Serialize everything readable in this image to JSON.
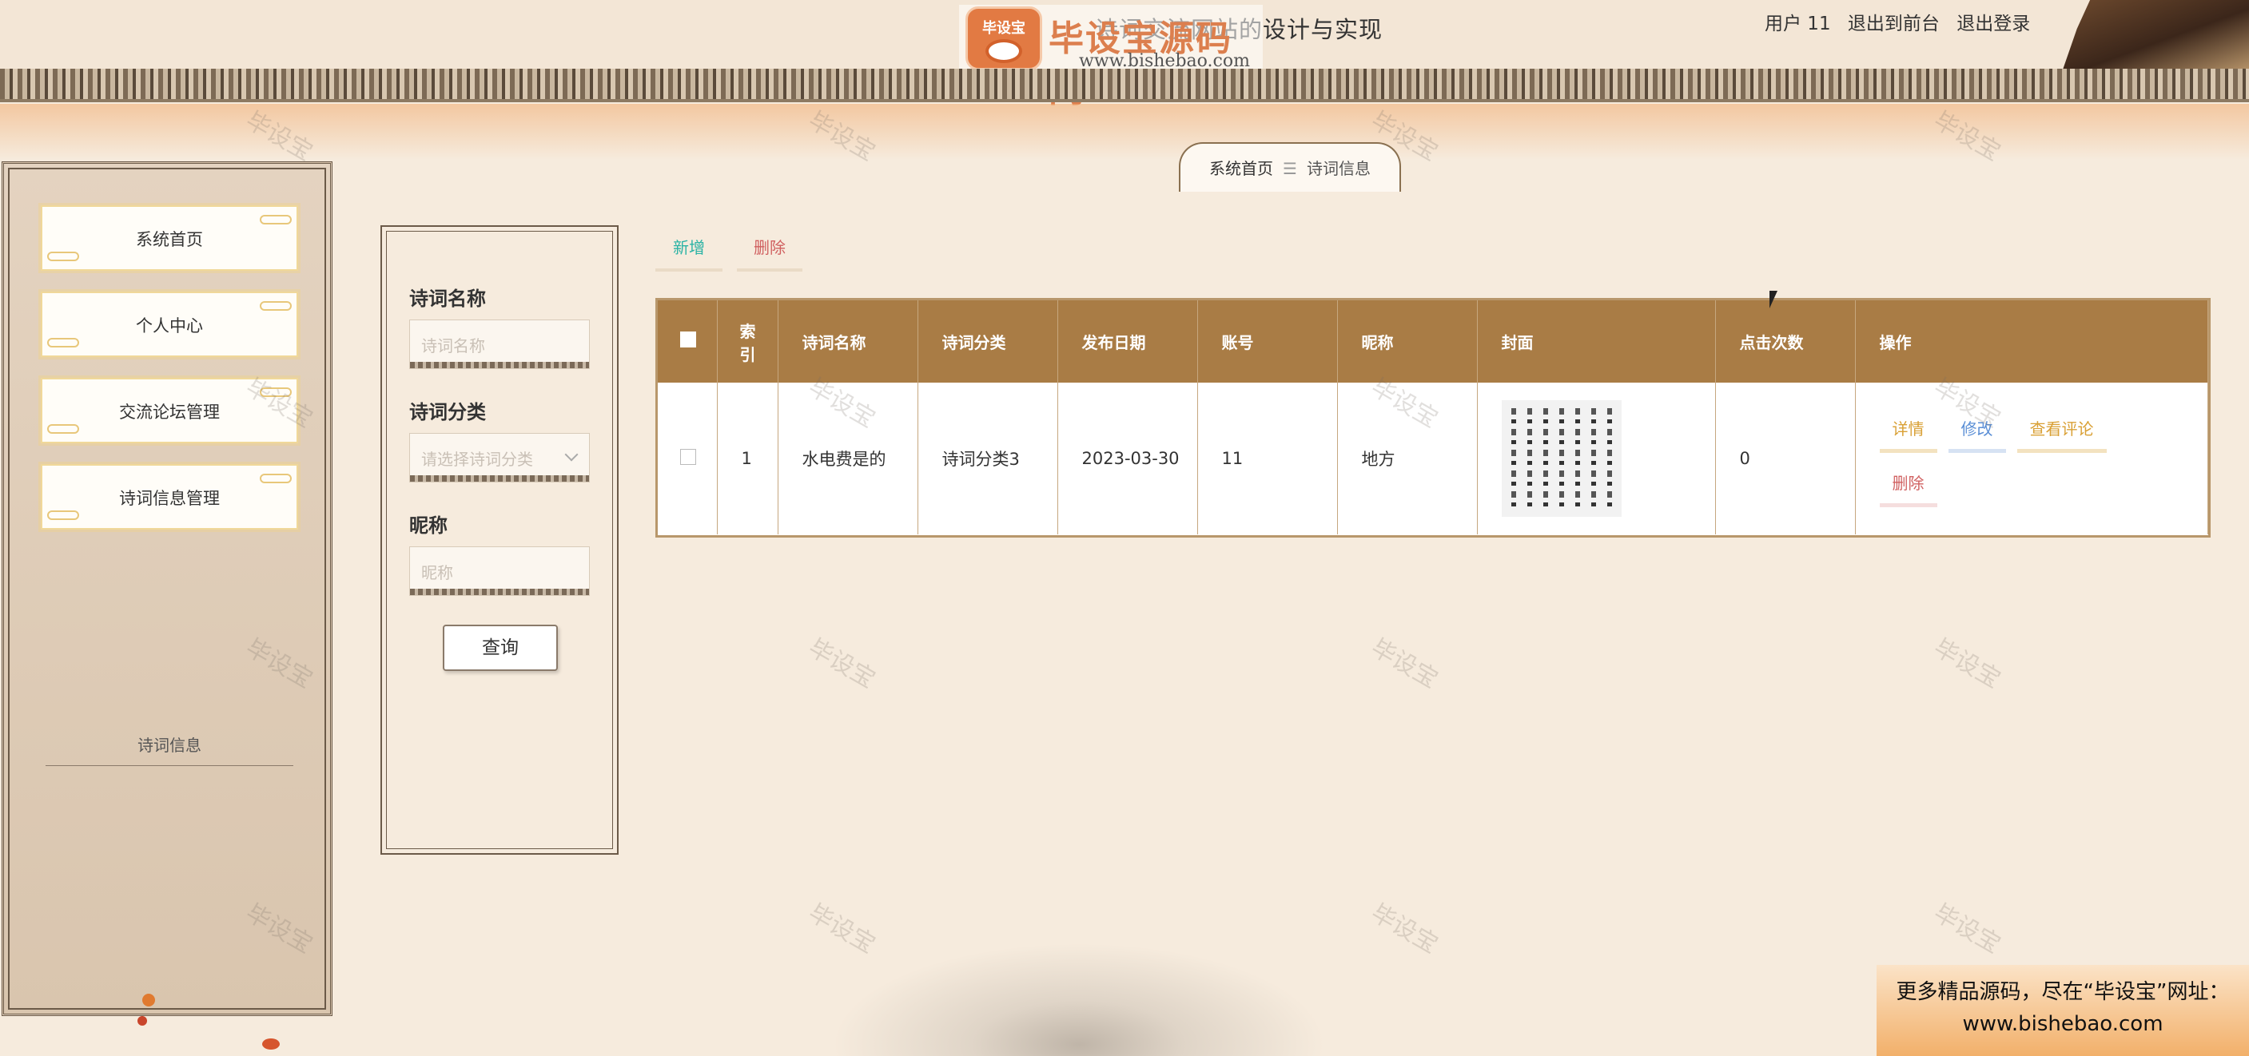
{
  "header": {
    "title": "诗词交流网站的设计与实现",
    "logo_badge": "毕设宝",
    "logo_cn": "毕设宝源码网",
    "logo_url": "www.bishebao.com",
    "user_label": "用户 11",
    "back_link": "退出到前台",
    "logout_link": "退出登录"
  },
  "breadcrumb": {
    "home": "系统首页",
    "separator": "☰",
    "current": "诗词信息"
  },
  "sidebar": {
    "items": [
      {
        "label": "系统首页"
      },
      {
        "label": "个人中心"
      },
      {
        "label": "交流论坛管理"
      },
      {
        "label": "诗词信息管理"
      }
    ],
    "sub_item": "诗词信息"
  },
  "search": {
    "fields": [
      {
        "label": "诗词名称",
        "placeholder": "诗词名称"
      },
      {
        "label": "诗词分类",
        "placeholder": "请选择诗词分类"
      },
      {
        "label": "昵称",
        "placeholder": "昵称"
      }
    ],
    "query_button": "查询"
  },
  "actions": {
    "add": "新增",
    "delete": "删除"
  },
  "table": {
    "columns": [
      "索引",
      "诗词名称",
      "诗词分类",
      "发布日期",
      "账号",
      "昵称",
      "封面",
      "点击次数",
      "操作"
    ],
    "rows": [
      {
        "index": "1",
        "name": "水电费是的",
        "category": "诗词分类3",
        "date": "2023-03-30",
        "account": "11",
        "nickname": "地方",
        "clicks": "0"
      }
    ],
    "ops": {
      "detail": "详情",
      "edit": "修改",
      "comment": "查看评论",
      "delete": "删除"
    }
  },
  "watermark": "毕设宝",
  "ad": {
    "line1": "更多精品源码，尽在“毕设宝”网址：",
    "line2": "www.bishebao.com"
  },
  "colors": {
    "table_header": "#a97c45",
    "add_button": "#2bb3a5",
    "delete": "#d06060",
    "detail": "#d9a035",
    "edit": "#5b8fd6"
  }
}
